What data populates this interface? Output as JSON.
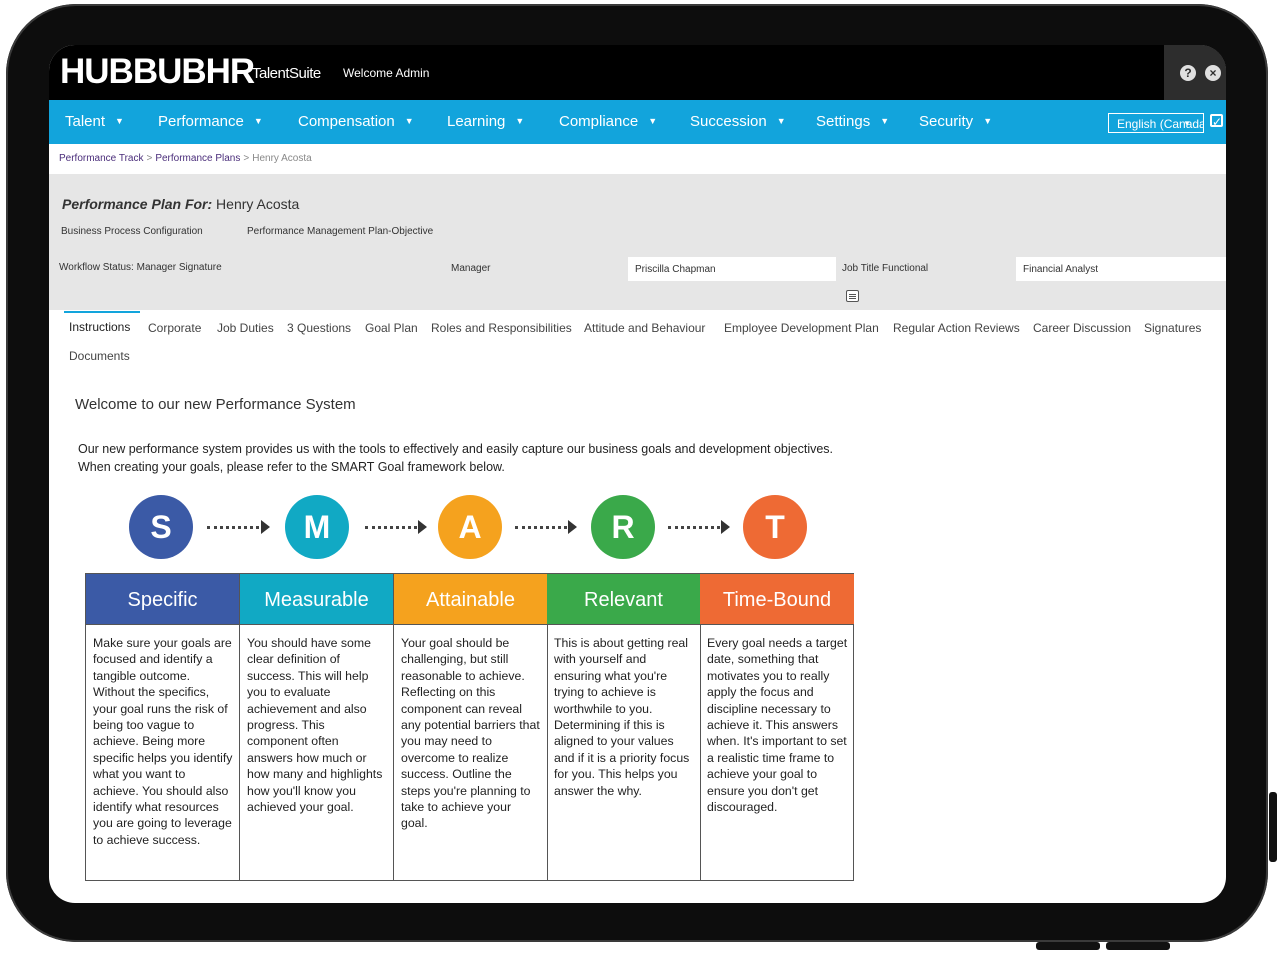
{
  "app": {
    "logo_main": "HUBBUBHR",
    "logo_sub": "TalentSuite",
    "welcome": "Welcome Admin"
  },
  "top_icons": {
    "help": "?",
    "close": "×"
  },
  "nav": {
    "items": [
      {
        "label": "Talent"
      },
      {
        "label": "Performance"
      },
      {
        "label": "Compensation"
      },
      {
        "label": "Learning"
      },
      {
        "label": "Compliance"
      },
      {
        "label": "Succession"
      },
      {
        "label": "Settings"
      },
      {
        "label": "Security"
      }
    ],
    "language": "English (Canada)"
  },
  "breadcrumb": {
    "items": [
      "Performance Track",
      "Performance Plans",
      "Henry Acosta"
    ]
  },
  "plan": {
    "title_label": "Performance Plan For:",
    "employee": "Henry Acosta",
    "bpc_label": "Business Process Configuration",
    "bpc_value": "Performance Management Plan-Objective",
    "workflow_status": "Workflow Status: Manager Signature",
    "manager_label": "Manager",
    "manager_value": "Priscilla Chapman",
    "job_title_label": "Job Title Functional",
    "job_title_value": "Financial Analyst"
  },
  "tabs": [
    "Instructions",
    "Corporate",
    "Job Duties",
    "3 Questions",
    "Goal Plan",
    "Roles and Responsibilities",
    "Attitude and Behaviour",
    "Employee Development Plan",
    "Regular Action Reviews",
    "Career Discussion",
    "Signatures",
    "Documents"
  ],
  "content": {
    "welcome_title": "Welcome to our new Performance System",
    "intro_line1": "Our new performance system provides us with the tools to effectively and easily capture our business goals and development objectives.",
    "intro_line2": "When creating your goals, please refer to the SMART Goal framework below."
  },
  "smart": [
    {
      "letter": "S",
      "title": "Specific",
      "color": "#3b5aa6",
      "text": "Make sure your goals are focused and identify a tangible outcome. Without the specifics, your goal runs the risk of being too vague to achieve. Being more specific helps you identify what you want to achieve. You should also identify what resources you are going to leverage to achieve success."
    },
    {
      "letter": "M",
      "title": "Measurable",
      "color": "#11a9c4",
      "text": "You should have some clear definition of success. This will help you to evaluate achievement and also progress. This component often answers how much or how many and highlights how you'll know you achieved your goal."
    },
    {
      "letter": "A",
      "title": "Attainable",
      "color": "#f5a21e",
      "text": "Your goal should be challenging, but still reasonable to achieve. Reflecting on this component can reveal any potential barriers that you may need to overcome to realize success. Outline the steps you're planning to take to achieve your goal."
    },
    {
      "letter": "R",
      "title": "Relevant",
      "color": "#3aa94a",
      "text": "This is about getting real with yourself and ensuring what you're trying to achieve is worthwhile to you. Determining if this is aligned to your values and if it is a priority focus for you. This helps you answer the why."
    },
    {
      "letter": "T",
      "title": "Time-Bound",
      "color": "#ee6a34",
      "text": "Every goal needs a target date, something that motivates you to really apply the focus and discipline necessary to achieve it. This answers when. It's important to set a realistic time frame to achieve your goal to ensure you don't get discouraged."
    }
  ],
  "colors": {
    "nav_bg": "#12a4dc",
    "top_bg": "#000000",
    "panel_bg": "#e6e6e6"
  }
}
